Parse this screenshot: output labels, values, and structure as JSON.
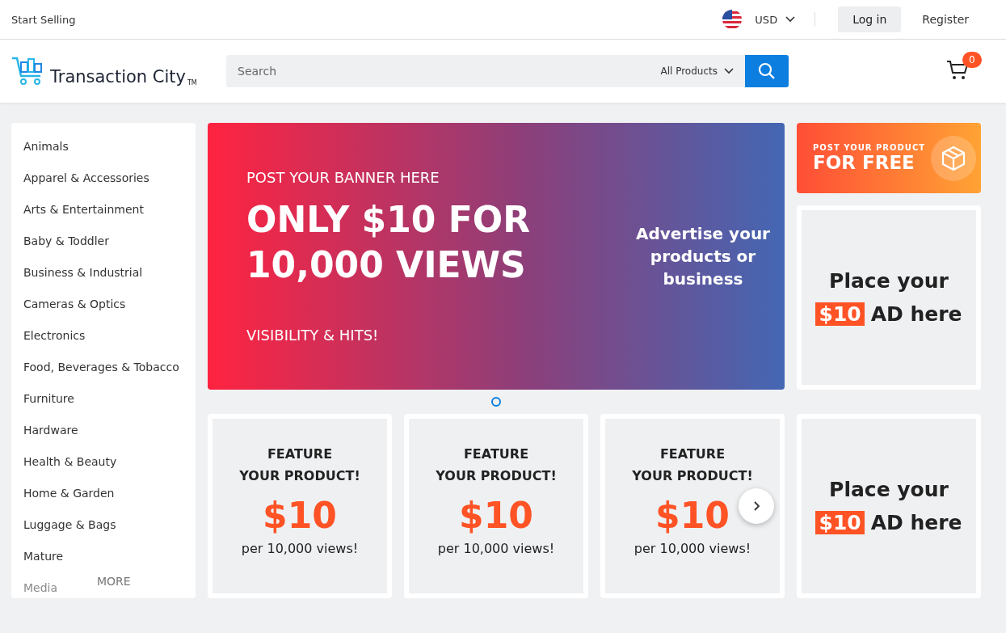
{
  "top_bar": {
    "start_selling": "Start Selling",
    "currency": "USD",
    "login": "Log in",
    "register": "Register"
  },
  "header": {
    "logo_text": "Transaction City",
    "logo_tm": "TM",
    "search": {
      "placeholder": "Search"
    },
    "category_select": "All Products",
    "cart_count": "0"
  },
  "categories": [
    "Animals",
    "Apparel & Accessories",
    "Arts & Entertainment",
    "Baby & Toddler",
    "Business & Industrial",
    "Cameras & Optics",
    "Electronics",
    "Food, Beverages & Tobacco",
    "Furniture",
    "Hardware",
    "Health & Beauty",
    "Home & Garden",
    "Luggage & Bags",
    "Mature",
    "Media"
  ],
  "more_button": "MORE",
  "banner": {
    "kicker": "POST YOUR BANNER HERE",
    "headline_1": "ONLY $10 FOR",
    "headline_2": "10,000 VIEWS",
    "footer": "VISIBILITY & HITS!",
    "side_text": "Advertise your products or business"
  },
  "promo": {
    "line_1": "POST YOUR PRODUCT",
    "line_2": "FOR FREE"
  },
  "ads": [
    {
      "line_1": "Place your",
      "price": "$10",
      "line_2": "AD here"
    },
    {
      "line_1": "Place your",
      "price": "$10",
      "line_2": "AD here"
    }
  ],
  "feature_cards": [
    {
      "title_1": "FEATURE",
      "title_2": "YOUR PRODUCT!",
      "price": "$10",
      "note": "per 10,000 views!"
    },
    {
      "title_1": "FEATURE",
      "title_2": "YOUR PRODUCT!",
      "price": "$10",
      "note": "per 10,000 views!"
    },
    {
      "title_1": "FEATURE",
      "title_2": "YOUR PRODUCT!",
      "price": "$10",
      "note": "per 10,000 views!"
    }
  ]
}
